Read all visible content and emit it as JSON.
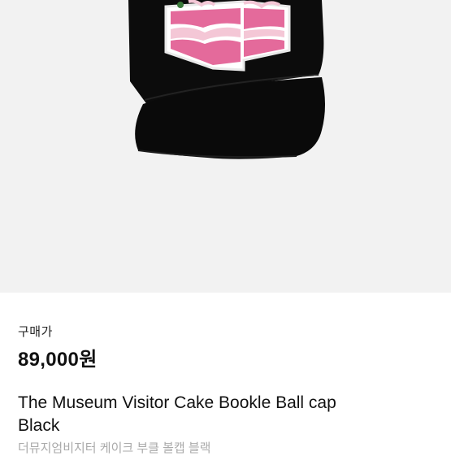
{
  "listing": {
    "price_label": "구매가",
    "price": "89,000원",
    "title": "The Museum Visitor Cake Bookle Ball cap Black",
    "subtitle": "더뮤지엄비지터 케이크 부클 볼캡 블랙"
  },
  "image": {
    "subject": "black ball cap with pink cake boucle patch",
    "background_color": "#f2f2f2",
    "cap_color": "#0b0b0b",
    "patch_pink": "#e46a9b",
    "patch_light": "#f4c7d6"
  }
}
